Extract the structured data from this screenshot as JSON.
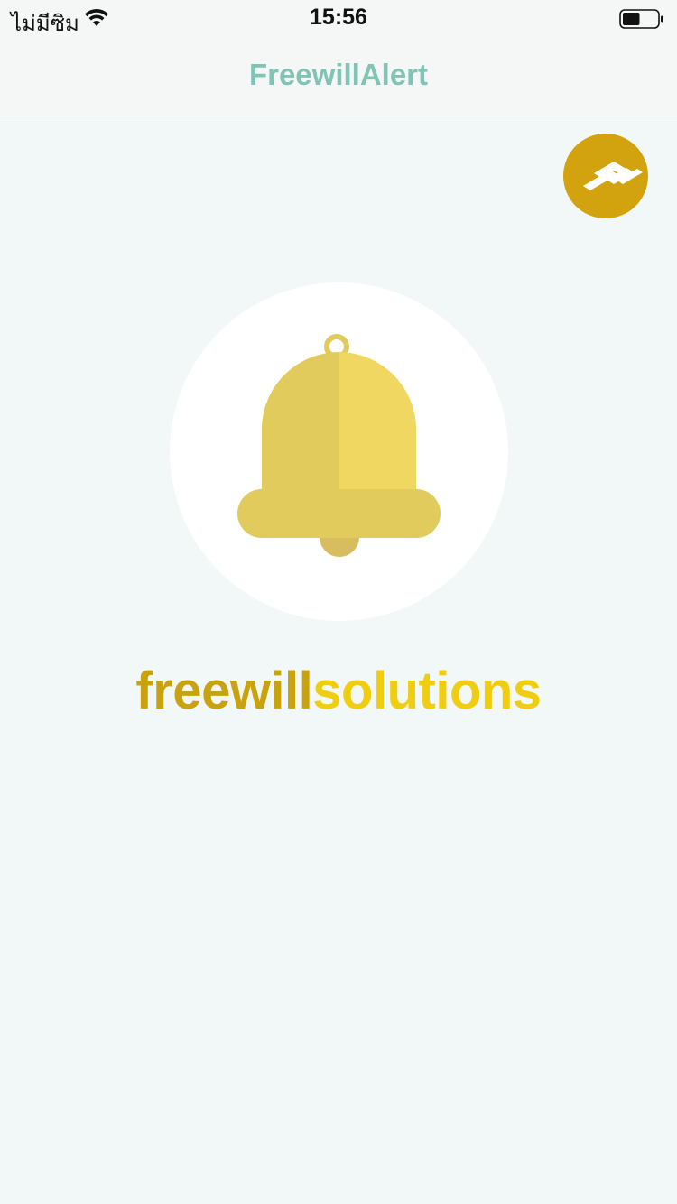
{
  "status_bar": {
    "carrier": "ไม่มีซิม",
    "time": "15:56",
    "battery_level": 0.5,
    "icons": [
      "wifi-icon",
      "battery-icon"
    ]
  },
  "nav": {
    "title": "FreewillAlert"
  },
  "logo": {
    "icon": "freewill-logo-icon",
    "color": "#d3a20f"
  },
  "hero": {
    "icon": "bell-icon",
    "bell_colors": {
      "left": "#e1cb5c",
      "right": "#f0d762",
      "clapper": "#d8bd5e"
    }
  },
  "brand": {
    "part1": "freewill",
    "part2": "solutions",
    "part1_color": "#c9a30f",
    "part2_color": "#f1cd12"
  },
  "colors": {
    "accent": "#7fc4b5",
    "background": "#f2f8f7"
  }
}
